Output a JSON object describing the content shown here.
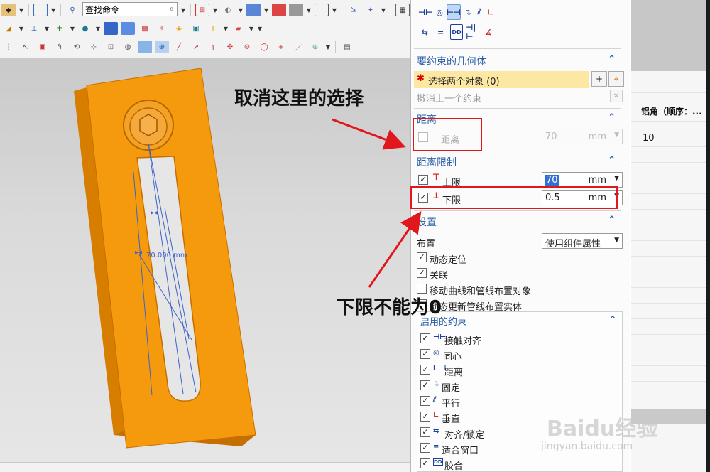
{
  "toolbar": {
    "command_search_value": "查找命令",
    "icons_row1": [
      "assembly-icon",
      "select-icon",
      "filter-icon",
      "view-icon",
      "shade-icon",
      "cube-icon",
      "box-icon",
      "layer-icon",
      "window-icon",
      "orient-icon",
      "render-icon",
      "table-icon"
    ],
    "icons_row2": [
      "sketch-icon",
      "datum-icon",
      "component-icon",
      "mate-icon",
      "move-icon",
      "array-icon",
      "pattern-icon",
      "explode-icon",
      "wave-icon",
      "brush-icon",
      "snap-icon",
      "measure-icon"
    ],
    "icons_row3": [
      "point-icon",
      "line-icon",
      "arc-icon",
      "spline-icon",
      "circle-icon",
      "curve-icon",
      "snap-grid-icon",
      "display-icon",
      "hide-icon",
      "select-filter-icon"
    ]
  },
  "viewport": {
    "dimension_label": "70.000 mm"
  },
  "dialog": {
    "constraint_type_icons": [
      "touch-align-icon",
      "concentric-icon",
      "distance-icon",
      "fix-icon",
      "parallel-icon",
      "perpendicular-icon",
      "align-lock-icon",
      "fit-icon",
      "bond-icon",
      "center-icon",
      "angle-icon"
    ],
    "geometry": {
      "header": "要约束的几何体",
      "select_label": "选择两个对象 (0)",
      "undo_label": "撤消上一个约束"
    },
    "distance": {
      "header": "距离",
      "checkbox_checked": false,
      "label": "距离",
      "value": "70",
      "unit": "mm"
    },
    "distance_limit": {
      "header": "距离限制",
      "upper_label": "上限",
      "upper_checked": true,
      "upper_value": "70",
      "upper_unit": "mm",
      "lower_label": "下限",
      "lower_checked": true,
      "lower_value": "0.5",
      "lower_unit": "mm"
    },
    "settings": {
      "header": "设置",
      "layout_label": "布置",
      "layout_value": "使用组件属性",
      "options": [
        {
          "label": "动态定位",
          "checked": true
        },
        {
          "label": "关联",
          "checked": true
        },
        {
          "label": "移动曲线和管线布置对象",
          "checked": false
        },
        {
          "label": "动态更新管线布置实体",
          "checked": false
        }
      ]
    },
    "enabled_constraints": {
      "header": "启用的约束",
      "items": [
        {
          "label": "接触对齐",
          "icon": "touch-align-icon",
          "checked": true
        },
        {
          "label": "同心",
          "icon": "concentric-icon",
          "checked": true
        },
        {
          "label": "距离",
          "icon": "distance-icon",
          "checked": true
        },
        {
          "label": "固定",
          "icon": "fix-icon",
          "checked": true
        },
        {
          "label": "平行",
          "icon": "parallel-icon",
          "checked": true
        },
        {
          "label": "垂直",
          "icon": "perpendicular-icon",
          "checked": true
        },
        {
          "label": "对齐/锁定",
          "icon": "align-lock-icon",
          "checked": true
        },
        {
          "label": "适合窗口",
          "icon": "fit-icon",
          "checked": true
        },
        {
          "label": "胶合",
          "icon": "bond-icon",
          "checked": true
        }
      ]
    }
  },
  "right_panel": {
    "header": "铝角（顺序：...",
    "cell_value": "10"
  },
  "annotations": {
    "top_note": "取消这里的选择",
    "bottom_note": "下限不能为0"
  },
  "watermark": {
    "brand": "Baidu经验",
    "url": "jingyan.baidu.com"
  },
  "colors": {
    "accent_blue": "#2a5ea8",
    "select_highlight": "#fce8a3",
    "annotation_red": "#e0171d",
    "part_orange": "#f59a0c"
  }
}
